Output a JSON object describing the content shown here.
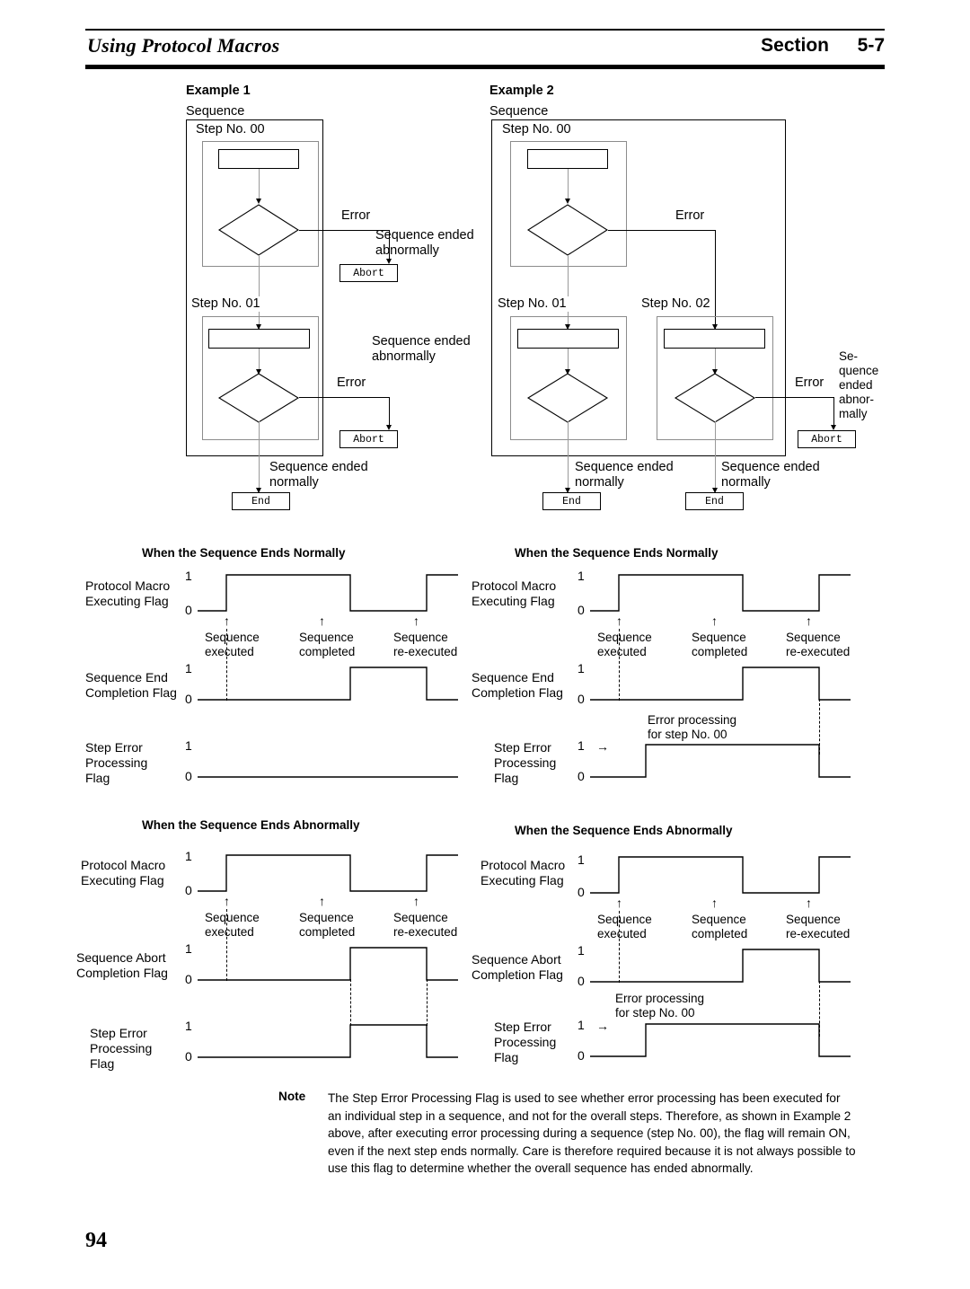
{
  "header": {
    "doc_title": "Using Protocol Macros",
    "section_word": "Section",
    "section_number": "5-7"
  },
  "page_number": "94",
  "examples": [
    {
      "heading": "Example 1",
      "sequence_label": "Sequence",
      "steps": [
        {
          "label": "Step No. 00"
        },
        {
          "label": "Step No. 01"
        }
      ],
      "branches": [
        {
          "error_label": "Error",
          "abnormal_text": "Sequence ended\nabnormally",
          "terminal": "Abort"
        },
        {
          "error_label": "Error",
          "abnormal_text": "Sequence ended\nabnormally",
          "terminal": "Abort"
        }
      ],
      "normal_exits": [
        {
          "text": "Sequence ended\nnormally",
          "terminal": "End"
        }
      ]
    },
    {
      "heading": "Example 2",
      "sequence_label": "Sequence",
      "steps": [
        {
          "label": "Step No. 00"
        },
        {
          "label": "Step No. 01"
        },
        {
          "label": "Step No. 02"
        }
      ],
      "branches": [
        {
          "error_label": "Error"
        },
        {
          "error_label": "Error",
          "abnormal_text": "Se-\nquence\nended\nabnor-\nmally",
          "terminal": "Abort"
        }
      ],
      "normal_exits": [
        {
          "text": "Sequence ended\nnormally",
          "terminal": "End"
        },
        {
          "text": "Sequence ended\nnormally",
          "terminal": "End"
        }
      ]
    }
  ],
  "timing_diagrams": [
    {
      "id": "ex1-normal",
      "title": "When the Sequence Ends Normally",
      "rows": [
        {
          "label": "Protocol Macro\nExecuting Flag",
          "high": "1",
          "low": "0"
        },
        {
          "label": "Sequence End\nCompletion Flag",
          "high": "1",
          "low": "0"
        },
        {
          "label": "Step Error\nProcessing\nFlag",
          "high": "1",
          "low": "0"
        }
      ],
      "events": [
        "Sequence\nexecuted",
        "Sequence\ncompleted",
        "Sequence\nre-executed"
      ],
      "annotation": null
    },
    {
      "id": "ex2-normal",
      "title": "When the Sequence Ends Normally",
      "rows": [
        {
          "label": "Protocol Macro\nExecuting Flag",
          "high": "1",
          "low": "0"
        },
        {
          "label": "Sequence End\nCompletion Flag",
          "high": "1",
          "low": "0"
        },
        {
          "label": "Step Error\nProcessing\nFlag",
          "high": "1",
          "low": "0"
        }
      ],
      "events": [
        "Sequence\nexecuted",
        "Sequence\ncompleted",
        "Sequence\nre-executed"
      ],
      "annotation": "Error processing\nfor step No. 00"
    },
    {
      "id": "ex1-abnormal",
      "title": "When the Sequence Ends Abnormally",
      "rows": [
        {
          "label": "Protocol Macro\nExecuting Flag",
          "high": "1",
          "low": "0"
        },
        {
          "label": "Sequence Abort\nCompletion Flag",
          "high": "1",
          "low": "0"
        },
        {
          "label": "Step Error\nProcessing\nFlag",
          "high": "1",
          "low": "0"
        }
      ],
      "events": [
        "Sequence\nexecuted",
        "Sequence\ncompleted",
        "Sequence\nre-executed"
      ],
      "annotation": null
    },
    {
      "id": "ex2-abnormal",
      "title": "When the Sequence Ends Abnormally",
      "rows": [
        {
          "label": "Protocol Macro\nExecuting Flag",
          "high": "1",
          "low": "0"
        },
        {
          "label": "Sequence Abort\nCompletion Flag",
          "high": "1",
          "low": "0"
        },
        {
          "label": "Step Error\nProcessing\nFlag",
          "high": "1",
          "low": "0"
        }
      ],
      "events": [
        "Sequence\nexecuted",
        "Sequence\ncompleted",
        "Sequence\nre-executed"
      ],
      "annotation": "Error processing\nfor step No. 00"
    }
  ],
  "note": {
    "label": "Note",
    "body": "The Step Error Processing Flag is used to see whether error processing has been executed for an individual step in a sequence, and not for the overall steps. Therefore, as shown in Example 2 above, after executing error processing during a sequence (step No. 00), the flag will remain ON, even if the next step ends normally. Care is therefore required because it is not always possible to use this flag to determine whether the overall sequence has ended abnormally."
  }
}
